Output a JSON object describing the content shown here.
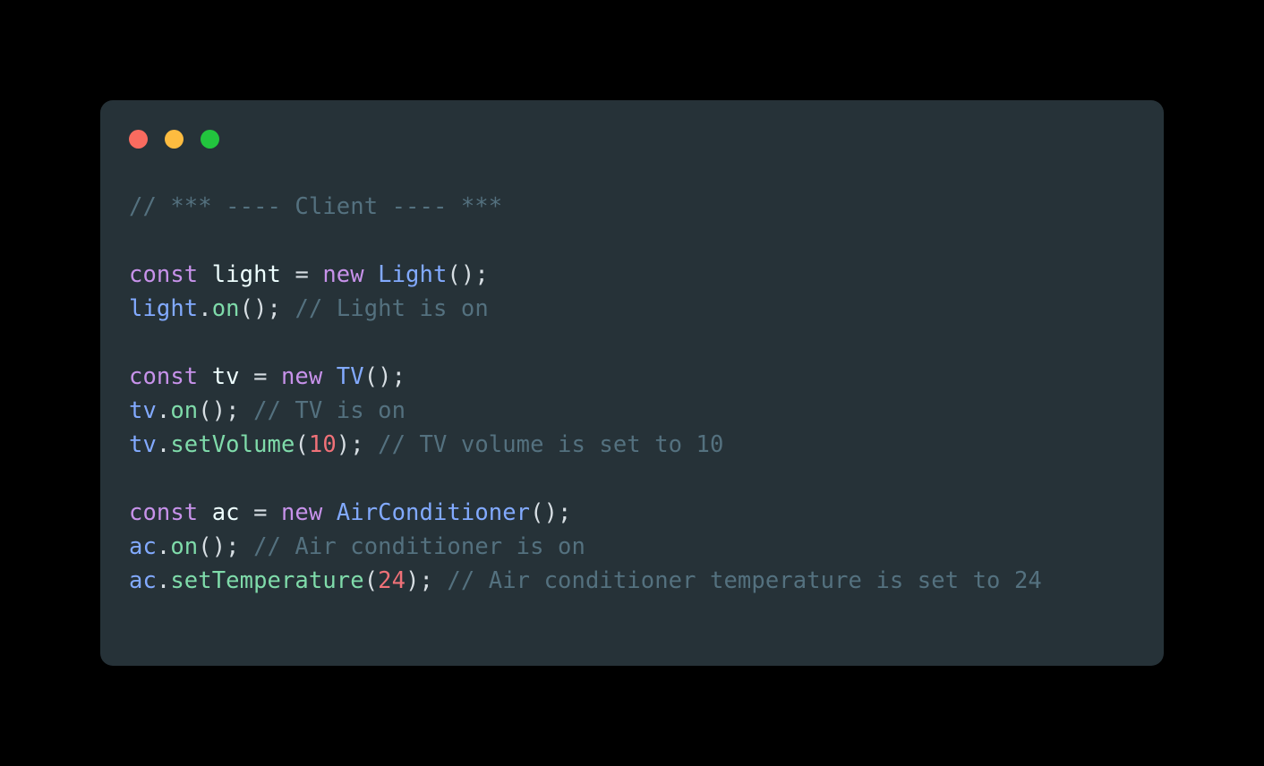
{
  "window": {
    "controls": [
      {
        "name": "close",
        "color": "#f96b5f"
      },
      {
        "name": "minimize",
        "color": "#fdbc40"
      },
      {
        "name": "maximize",
        "color": "#22c53e"
      }
    ]
  },
  "theme": {
    "page_background": "#000000",
    "card_background": "#263238",
    "comment": "#54717f",
    "keyword": "#c792ea",
    "class_name": "#82aaff",
    "variable": "#82aaff",
    "method": "#7fdbaa",
    "number": "#f07178",
    "punctuation": "#d7dee3",
    "plain_text": "#eeffff"
  },
  "code": {
    "language": "javascript",
    "plain_text": "// *** ---- Client ---- ***\n\nconst light = new Light();\nlight.on(); // Light is on\n\nconst tv = new TV();\ntv.on(); // TV is on\ntv.setVolume(10); // TV volume is set to 10\n\nconst ac = new AirConditioner();\nac.on(); // Air conditioner is on\nac.setTemperature(24); // Air conditioner temperature is set to 24",
    "lines": [
      {
        "id": "line-1",
        "tokens": [
          {
            "t": "// *** ---- Client ---- ***",
            "k": "comment"
          }
        ]
      },
      {
        "id": "line-2",
        "blank": true,
        "tokens": []
      },
      {
        "id": "line-3",
        "tokens": [
          {
            "t": "const",
            "k": "keyword"
          },
          {
            "t": " ",
            "k": "plain"
          },
          {
            "t": "light",
            "k": "plain"
          },
          {
            "t": " ",
            "k": "plain"
          },
          {
            "t": "=",
            "k": "op"
          },
          {
            "t": " ",
            "k": "plain"
          },
          {
            "t": "new",
            "k": "keyword"
          },
          {
            "t": " ",
            "k": "plain"
          },
          {
            "t": "Light",
            "k": "class"
          },
          {
            "t": "();",
            "k": "punct"
          }
        ]
      },
      {
        "id": "line-4",
        "tokens": [
          {
            "t": "light",
            "k": "var"
          },
          {
            "t": ".",
            "k": "punct"
          },
          {
            "t": "on",
            "k": "method"
          },
          {
            "t": "();",
            "k": "punct"
          },
          {
            "t": " ",
            "k": "plain"
          },
          {
            "t": "// Light is on",
            "k": "comment"
          }
        ]
      },
      {
        "id": "line-5",
        "blank": true,
        "tokens": []
      },
      {
        "id": "line-6",
        "tokens": [
          {
            "t": "const",
            "k": "keyword"
          },
          {
            "t": " ",
            "k": "plain"
          },
          {
            "t": "tv",
            "k": "plain"
          },
          {
            "t": " ",
            "k": "plain"
          },
          {
            "t": "=",
            "k": "op"
          },
          {
            "t": " ",
            "k": "plain"
          },
          {
            "t": "new",
            "k": "keyword"
          },
          {
            "t": " ",
            "k": "plain"
          },
          {
            "t": "TV",
            "k": "class"
          },
          {
            "t": "();",
            "k": "punct"
          }
        ]
      },
      {
        "id": "line-7",
        "tokens": [
          {
            "t": "tv",
            "k": "var"
          },
          {
            "t": ".",
            "k": "punct"
          },
          {
            "t": "on",
            "k": "method"
          },
          {
            "t": "();",
            "k": "punct"
          },
          {
            "t": " ",
            "k": "plain"
          },
          {
            "t": "// TV is on",
            "k": "comment"
          }
        ]
      },
      {
        "id": "line-8",
        "tokens": [
          {
            "t": "tv",
            "k": "var"
          },
          {
            "t": ".",
            "k": "punct"
          },
          {
            "t": "setVolume",
            "k": "method"
          },
          {
            "t": "(",
            "k": "punct"
          },
          {
            "t": "10",
            "k": "number"
          },
          {
            "t": ");",
            "k": "punct"
          },
          {
            "t": " ",
            "k": "plain"
          },
          {
            "t": "// TV volume is set to 10",
            "k": "comment"
          }
        ]
      },
      {
        "id": "line-9",
        "blank": true,
        "tokens": []
      },
      {
        "id": "line-10",
        "tokens": [
          {
            "t": "const",
            "k": "keyword"
          },
          {
            "t": " ",
            "k": "plain"
          },
          {
            "t": "ac",
            "k": "plain"
          },
          {
            "t": " ",
            "k": "plain"
          },
          {
            "t": "=",
            "k": "op"
          },
          {
            "t": " ",
            "k": "plain"
          },
          {
            "t": "new",
            "k": "keyword"
          },
          {
            "t": " ",
            "k": "plain"
          },
          {
            "t": "AirConditioner",
            "k": "class"
          },
          {
            "t": "();",
            "k": "punct"
          }
        ]
      },
      {
        "id": "line-11",
        "tokens": [
          {
            "t": "ac",
            "k": "var"
          },
          {
            "t": ".",
            "k": "punct"
          },
          {
            "t": "on",
            "k": "method"
          },
          {
            "t": "();",
            "k": "punct"
          },
          {
            "t": " ",
            "k": "plain"
          },
          {
            "t": "// Air conditioner is on",
            "k": "comment"
          }
        ]
      },
      {
        "id": "line-12",
        "tokens": [
          {
            "t": "ac",
            "k": "var"
          },
          {
            "t": ".",
            "k": "punct"
          },
          {
            "t": "setTemperature",
            "k": "method"
          },
          {
            "t": "(",
            "k": "punct"
          },
          {
            "t": "24",
            "k": "number"
          },
          {
            "t": ");",
            "k": "punct"
          },
          {
            "t": " ",
            "k": "plain"
          },
          {
            "t": "// Air conditioner temperature is set to 24",
            "k": "comment"
          }
        ]
      }
    ]
  }
}
